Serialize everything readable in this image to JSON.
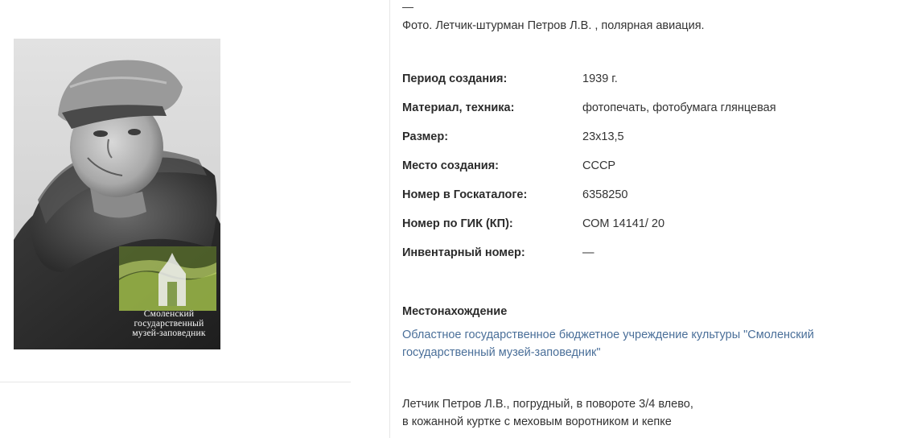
{
  "caption_dash": "—",
  "caption": "Фото. Летчик-штурман Петров Л.В. , полярная авиация.",
  "properties": [
    {
      "label": "Период создания:",
      "value": "1939 г."
    },
    {
      "label": "Материал, техника:",
      "value": "фотопечать, фотобумага глянцевая"
    },
    {
      "label": "Размер:",
      "value": "23х13,5"
    },
    {
      "label": "Место создания:",
      "value": "СССР"
    },
    {
      "label": "Номер в Госкаталоге:",
      "value": "6358250"
    },
    {
      "label": "Номер по ГИК (КП):",
      "value": "СОМ 14141/ 20"
    },
    {
      "label": "Инвентарный номер:",
      "value": "—"
    }
  ],
  "location": {
    "heading": "Местонахождение",
    "link_text": "Областное государственное бюджетное учреждение культуры \"Смоленский государственный музей-заповедник\""
  },
  "description": {
    "line1": "Летчик Петров Л.В., погрудный, в повороте 3/4 влево,",
    "line2": "в кожанной куртке с меховым воротником и кепке"
  },
  "watermark": {
    "line1": "Смоленский",
    "line2": "государственный",
    "line3": "музей-заповедник"
  },
  "colors": {
    "link": "#4a6f99",
    "watermark_green": "#8fae3a"
  }
}
